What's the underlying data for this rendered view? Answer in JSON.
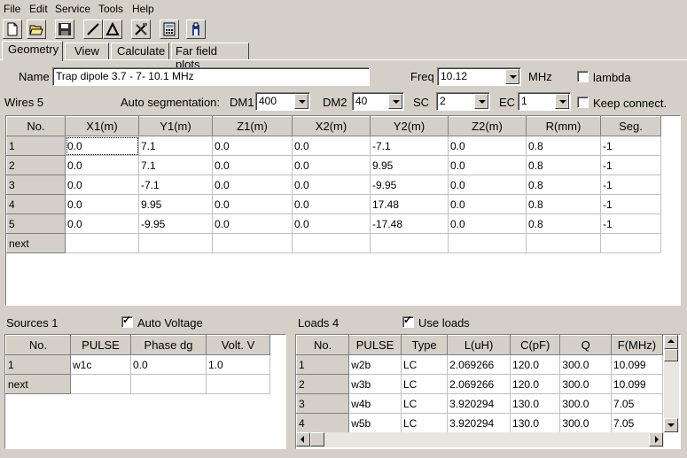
{
  "menu": [
    "File",
    "Edit",
    "Service",
    "Tools",
    "Help"
  ],
  "toolbar_icons": [
    "new-file-icon",
    "open-folder-icon",
    "save-disk-icon",
    "line-tool-icon",
    "triangle-tool-icon",
    "tools-icon",
    "calculator-icon",
    "antenna-icon"
  ],
  "tabs": [
    "Geometry",
    "View",
    "Calculate",
    "Far field plots"
  ],
  "name_label": "Name",
  "name_value": "Trap dipole 3.7 - 7- 10.1 MHz",
  "freq_label": "Freq",
  "freq_value": "10.12",
  "freq_unit": "MHz",
  "lambda_label": "lambda",
  "wires_label": "Wires 5",
  "autoseg_label": "Auto segmentation:",
  "dm1_label": "DM1",
  "dm1_value": "400",
  "dm2_label": "DM2",
  "dm2_value": "40",
  "sc_label": "SC",
  "sc_value": "2",
  "ec_label": "EC",
  "ec_value": "1",
  "keep_label": "Keep connect.",
  "wires": {
    "headers": [
      "No.",
      "X1(m)",
      "Y1(m)",
      "Z1(m)",
      "X2(m)",
      "Y2(m)",
      "Z2(m)",
      "R(mm)",
      "Seg."
    ],
    "rows": [
      [
        "1",
        "0.0",
        "7.1",
        "0.0",
        "0.0",
        "-7.1",
        "0.0",
        "0.8",
        "-1"
      ],
      [
        "2",
        "0.0",
        "7.1",
        "0.0",
        "0.0",
        "9.95",
        "0.0",
        "0.8",
        "-1"
      ],
      [
        "3",
        "0.0",
        "-7.1",
        "0.0",
        "0.0",
        "-9.95",
        "0.0",
        "0.8",
        "-1"
      ],
      [
        "4",
        "0.0",
        "9.95",
        "0.0",
        "0.0",
        "17.48",
        "0.0",
        "0.8",
        "-1"
      ],
      [
        "5",
        "0.0",
        "-9.95",
        "0.0",
        "0.0",
        "-17.48",
        "0.0",
        "0.8",
        "-1"
      ],
      [
        "next",
        "",
        "",
        "",
        "",
        "",
        "",
        "",
        ""
      ]
    ]
  },
  "sources_label": "Sources 1",
  "auto_voltage_label": "Auto Voltage",
  "sources": {
    "headers": [
      "No.",
      "PULSE",
      "Phase dg",
      "Volt. V"
    ],
    "rows": [
      [
        "1",
        "w1c",
        "0.0",
        "1.0"
      ],
      [
        "next",
        "",
        "",
        ""
      ]
    ]
  },
  "loads_label": "Loads 4",
  "use_loads_label": "Use loads",
  "loads": {
    "headers": [
      "No.",
      "PULSE",
      "Type",
      "L(uH)",
      "C(pF)",
      "Q",
      "F(MHz)"
    ],
    "rows": [
      [
        "1",
        "w2b",
        "LC",
        "2.069266",
        "120.0",
        "300.0",
        "10.099"
      ],
      [
        "2",
        "w3b",
        "LC",
        "2.069266",
        "120.0",
        "300.0",
        "10.099"
      ],
      [
        "3",
        "w4b",
        "LC",
        "3.920294",
        "130.0",
        "300.0",
        "7.05"
      ],
      [
        "4",
        "w5b",
        "LC",
        "3.920294",
        "130.0",
        "300.0",
        "7.05"
      ]
    ]
  }
}
